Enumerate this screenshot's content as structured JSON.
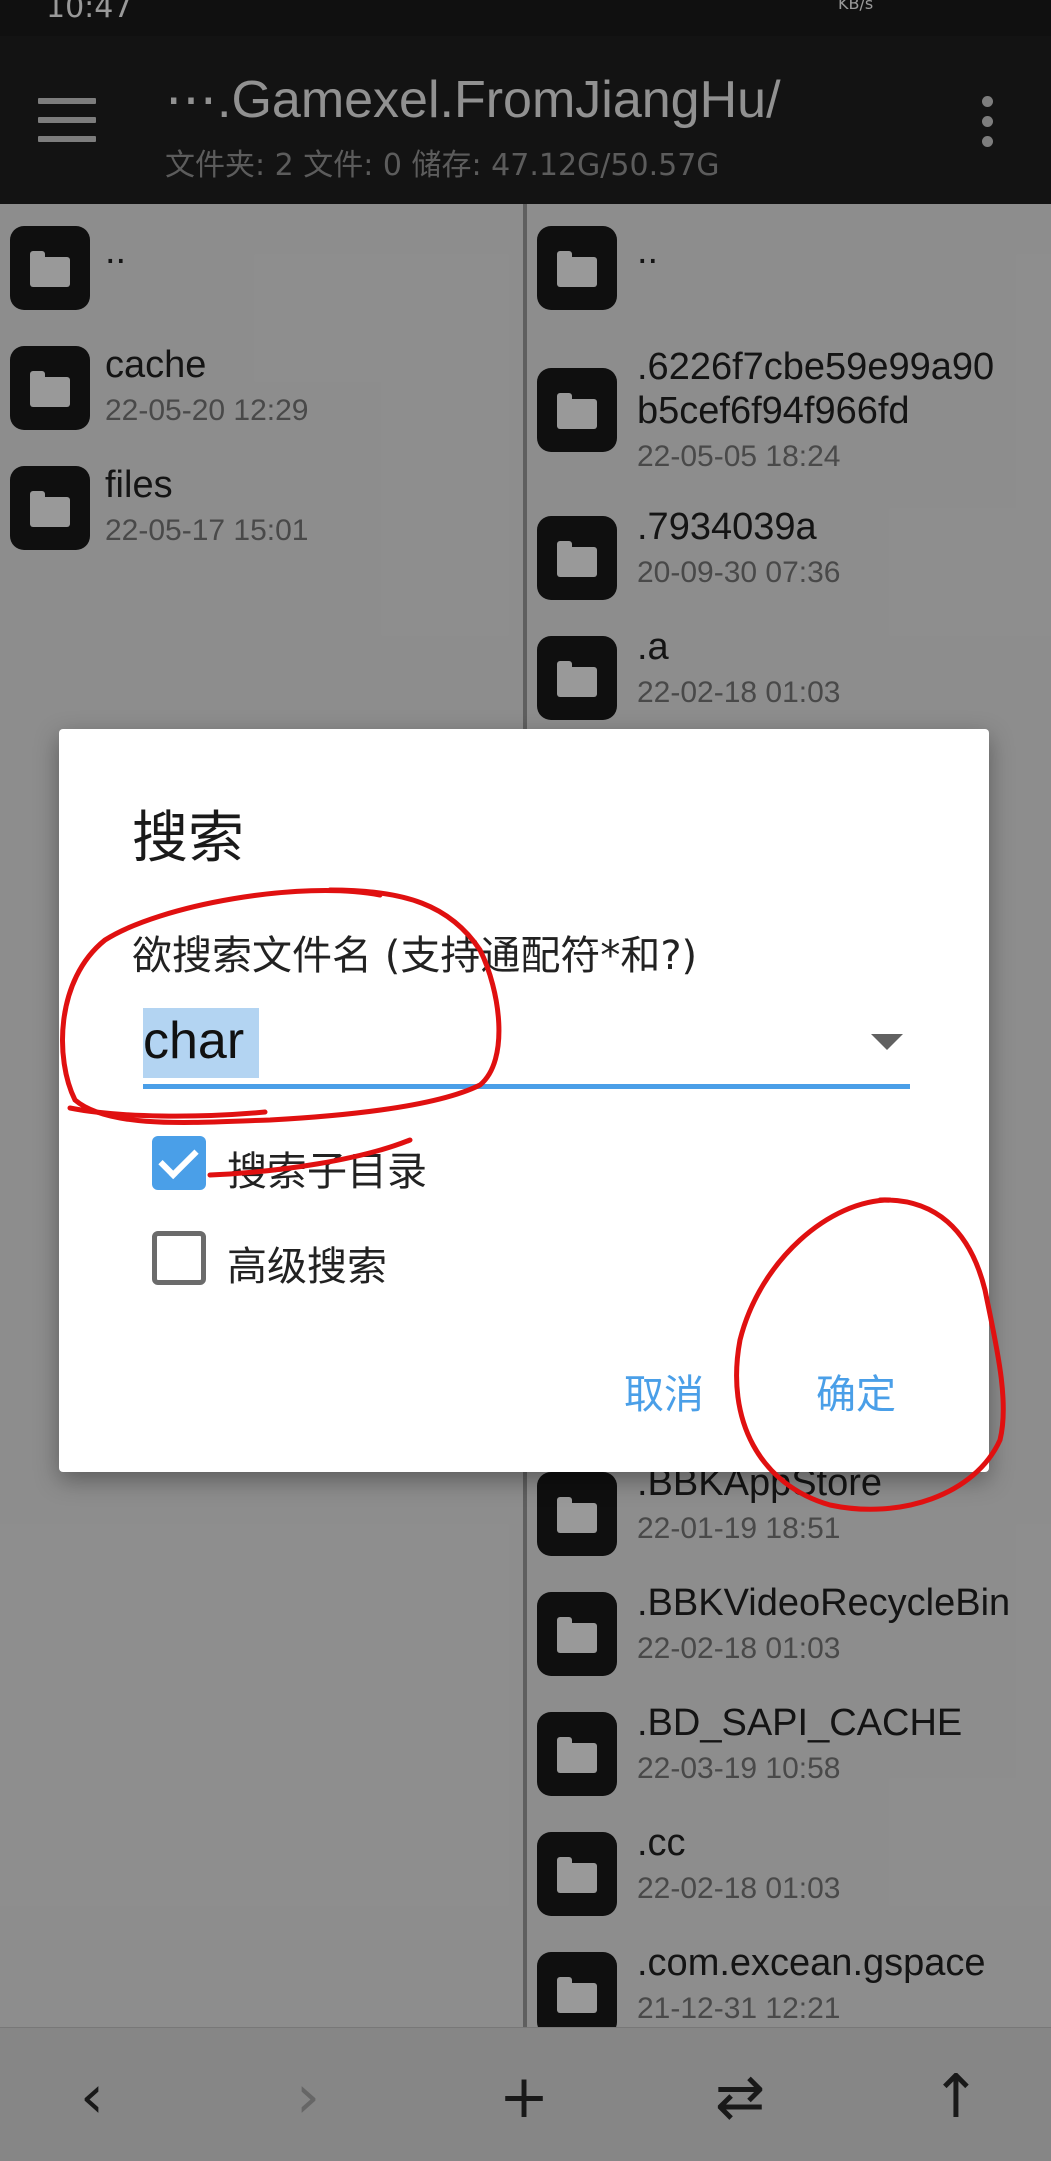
{
  "status_bar": {
    "time": "10:47",
    "speed_unit": "KB/s"
  },
  "app_bar": {
    "path": "⋯.Gamexel.FromJiangHu/",
    "info": "文件夹: 2  文件: 0  储存: 47.12G/50.57G"
  },
  "left_pane": {
    "items": [
      {
        "name": "..",
        "date": ""
      },
      {
        "name": "cache",
        "date": "22-05-20 12:29"
      },
      {
        "name": "files",
        "date": "22-05-17 15:01"
      }
    ]
  },
  "right_pane": {
    "items": [
      {
        "name": "..",
        "date": ""
      },
      {
        "name": ".6226f7cbe59e99a90",
        "name2": "b5cef6f94f966fd",
        "date": "22-05-05 18:24"
      },
      {
        "name": ".7934039a",
        "date": "20-09-30 07:36"
      },
      {
        "name": ".a",
        "date": "22-02-18 01:03"
      },
      {
        "name": ".BBKAppStore",
        "date": "22-01-19 18:51"
      },
      {
        "name": ".BBKVideoRecycleBin",
        "date": "22-02-18 01:03"
      },
      {
        "name": ".BD_SAPI_CACHE",
        "date": "22-03-19 10:58"
      },
      {
        "name": ".cc",
        "date": "22-02-18 01:03"
      },
      {
        "name": ".com.excean.gspace",
        "date": "21-12-31 12:21"
      }
    ]
  },
  "dialog": {
    "title": "搜索",
    "label": "欲搜索文件名 (支持通配符*和?)",
    "input_value": "char",
    "checkbox_subdir": {
      "label": "搜索子目录",
      "checked": true
    },
    "checkbox_advanced": {
      "label": "高级搜索",
      "checked": false
    },
    "cancel": "取消",
    "ok": "确定"
  },
  "bottom_bar": {
    "icons": [
      "back-icon",
      "forward-icon",
      "add-icon",
      "swap-icon",
      "up-icon"
    ],
    "glyphs": [
      "‹",
      "›",
      "+",
      "⇄",
      "↑"
    ]
  },
  "colors": {
    "accent": "#4a9fe8",
    "annotation": "#e01010",
    "app_bar": "#212121"
  }
}
